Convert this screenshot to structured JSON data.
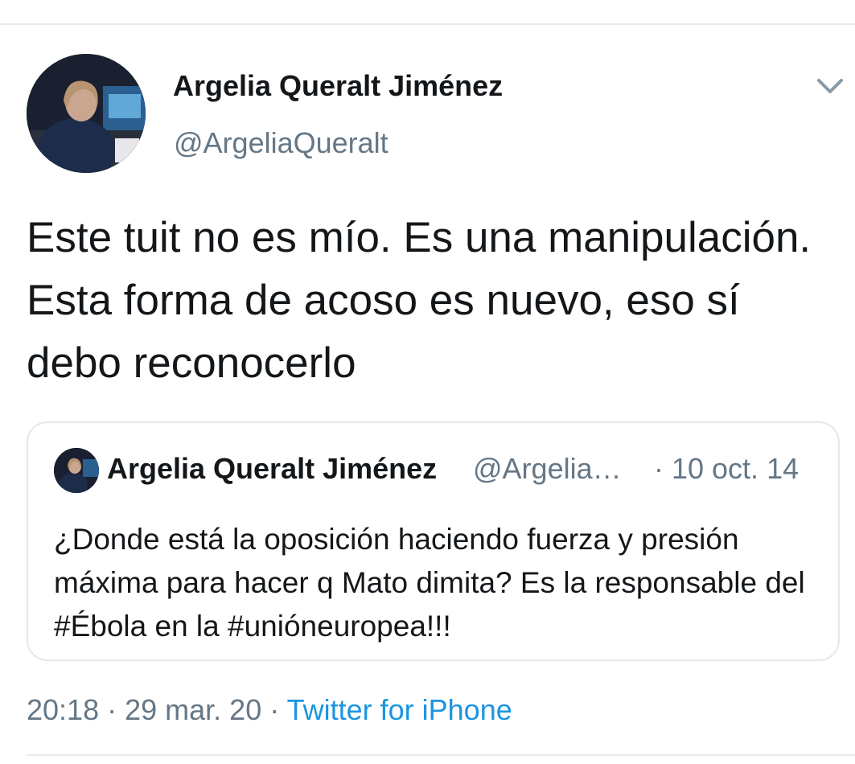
{
  "author": {
    "display_name": "Argelia Queralt Jiménez",
    "handle": "@ArgeliaQueralt"
  },
  "tweet": {
    "text": "Este tuit no es mío. Es una manipulación. Esta forma de acoso es nuevo, eso sí debo reconocerlo",
    "time": "20:18",
    "date": "29 mar. 20",
    "separator": "·",
    "source": "Twitter for iPhone"
  },
  "quoted_tweet": {
    "display_name": "Argelia Queralt Jiménez",
    "handle": "@Argelia…",
    "date": "· 10 oct. 14",
    "text": "¿Donde está la oposición haciendo fuerza y presión máxima para hacer q Mato dimita? Es la responsable del #Ébola en la #unióneuropea!!!"
  },
  "icons": {
    "caret": "chevron-down-icon"
  },
  "colors": {
    "text": "#14171a",
    "secondary": "#657786",
    "link": "#1b95e0",
    "border": "#e1e8ed"
  }
}
